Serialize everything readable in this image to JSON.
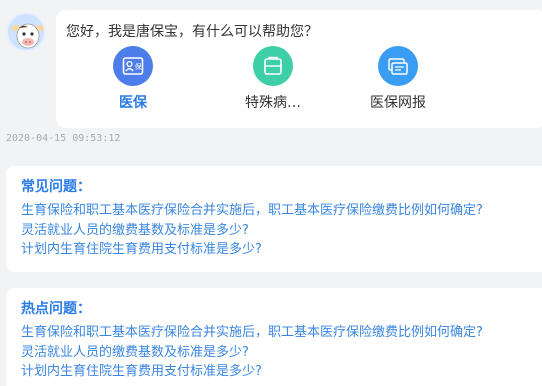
{
  "chat": {
    "greeting": "您好，我是唐保宝，有什么可以帮助您？",
    "services": [
      {
        "label": "医保",
        "icon": "insurance-card-icon",
        "color": "#4d7de8",
        "active": true
      },
      {
        "label": "特殊病…",
        "icon": "medical-kit-icon",
        "color": "#3ecfa8",
        "active": false
      },
      {
        "label": "医保网报",
        "icon": "online-card-icon",
        "color": "#3a9cf2",
        "active": false
      }
    ],
    "timestamp": "2020-04-15 09:53:12"
  },
  "faq": {
    "common_title": "常见问题：",
    "common_questions": [
      "生育保险和职工基本医疗保险合并实施后，职工基本医疗保险缴费比例如何确定?",
      "灵活就业人员的缴费基数及标准是多少?",
      "计划内生育住院生育费用支付标准是多少?"
    ],
    "hot_title": "热点问题：",
    "hot_questions": [
      "生育保险和职工基本医疗保险合并实施后，职工基本医疗保险缴费比例如何确定?",
      "灵活就业人员的缴费基数及标准是多少?",
      "计划内生育住院生育费用支付标准是多少?"
    ]
  },
  "colors": {
    "accent": "#2b7be6",
    "link": "#3a86e0",
    "background": "#f2f3f5"
  }
}
